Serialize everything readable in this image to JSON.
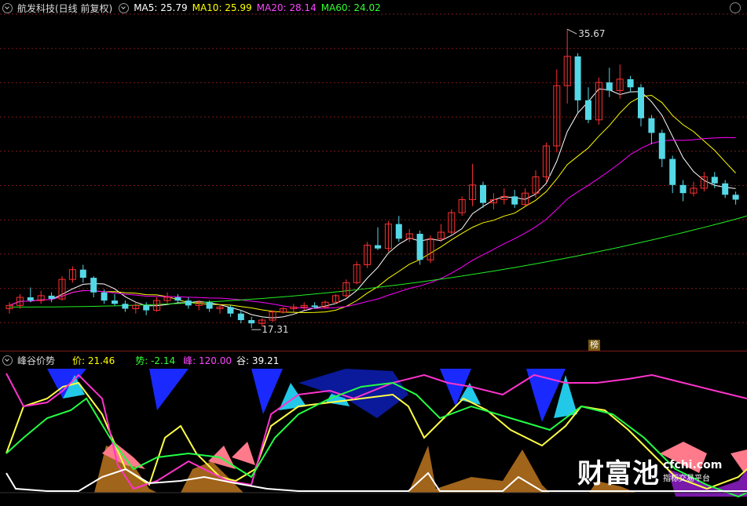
{
  "main_panel": {
    "title": "航发科技(日线 前复权)",
    "ma": [
      {
        "label": "MA5: 25.79",
        "color": "#ffffff"
      },
      {
        "label": "MA10: 25.99",
        "color": "#ffff00"
      },
      {
        "label": "MA20: 28.14",
        "color": "#ff00ff"
      },
      {
        "label": "MA60: 24.02",
        "color": "#00ff00"
      }
    ],
    "high_label": "35.67",
    "low_label": "17.31",
    "badge": "榜"
  },
  "indicator_panel": {
    "title": "峰谷价势",
    "values": [
      {
        "label": "价: 21.46",
        "color": "#ffff00"
      },
      {
        "label": "势: -2.14",
        "color": "#00ff00"
      },
      {
        "label": "峰: 120.00",
        "color": "#ff00ff"
      },
      {
        "label": "谷: 39.21",
        "color": "#ffffff"
      }
    ]
  },
  "watermark": {
    "big": "财富池",
    "site": "cfchi.com",
    "tagline": "指标交易平台"
  },
  "colors": {
    "up": "#ff3030",
    "down": "#55d8e6",
    "grid": "#7a1a1a"
  },
  "chart_data": {
    "type": "candlestick",
    "price_range": [
      16.5,
      36.5
    ],
    "candles": [
      [
        18.5,
        18.9,
        18.2,
        18.7
      ],
      [
        18.7,
        19.4,
        18.5,
        19.2
      ],
      [
        19.2,
        19.8,
        18.9,
        19.0
      ],
      [
        19.0,
        19.6,
        18.8,
        19.3
      ],
      [
        19.3,
        19.5,
        18.9,
        19.1
      ],
      [
        19.1,
        20.5,
        19.0,
        20.3
      ],
      [
        20.3,
        21.1,
        20.1,
        20.9
      ],
      [
        20.9,
        21.2,
        20.1,
        20.4
      ],
      [
        20.4,
        20.5,
        19.2,
        19.5
      ],
      [
        19.5,
        19.7,
        18.8,
        19.0
      ],
      [
        19.0,
        19.4,
        18.7,
        18.8
      ],
      [
        18.8,
        19.0,
        18.3,
        18.5
      ],
      [
        18.5,
        18.9,
        18.2,
        18.7
      ],
      [
        18.7,
        18.9,
        18.1,
        18.4
      ],
      [
        18.4,
        19.2,
        18.3,
        19.0
      ],
      [
        19.0,
        19.5,
        18.8,
        19.2
      ],
      [
        19.2,
        19.4,
        18.9,
        19.0
      ],
      [
        19.0,
        19.2,
        18.5,
        18.7
      ],
      [
        18.7,
        19.0,
        18.4,
        18.9
      ],
      [
        18.9,
        19.0,
        18.3,
        18.5
      ],
      [
        18.5,
        18.8,
        18.2,
        18.6
      ],
      [
        18.6,
        18.7,
        18.0,
        18.2
      ],
      [
        18.2,
        18.4,
        17.6,
        17.8
      ],
      [
        17.8,
        18.0,
        17.31,
        17.6
      ],
      [
        17.6,
        17.9,
        17.4,
        17.8
      ],
      [
        17.8,
        18.4,
        17.7,
        18.3
      ],
      [
        18.3,
        18.6,
        18.2,
        18.5
      ],
      [
        18.5,
        18.8,
        18.3,
        18.6
      ],
      [
        18.6,
        18.9,
        18.4,
        18.7
      ],
      [
        18.7,
        18.9,
        18.5,
        18.6
      ],
      [
        18.6,
        19.0,
        18.5,
        18.9
      ],
      [
        18.9,
        19.4,
        18.8,
        19.3
      ],
      [
        19.3,
        20.3,
        19.2,
        20.1
      ],
      [
        20.1,
        21.4,
        20.0,
        21.2
      ],
      [
        21.2,
        22.6,
        21.0,
        22.4
      ],
      [
        22.4,
        23.5,
        22.1,
        22.2
      ],
      [
        22.2,
        23.9,
        22.0,
        23.7
      ],
      [
        23.7,
        24.2,
        22.6,
        22.8
      ],
      [
        22.8,
        23.4,
        22.6,
        23.1
      ],
      [
        23.1,
        23.3,
        21.2,
        21.5
      ],
      [
        21.5,
        23.0,
        21.3,
        22.8
      ],
      [
        22.8,
        23.7,
        22.6,
        23.2
      ],
      [
        23.2,
        24.6,
        23.0,
        24.4
      ],
      [
        24.4,
        25.4,
        24.2,
        25.2
      ],
      [
        25.2,
        27.4,
        24.8,
        26.1
      ],
      [
        26.1,
        26.3,
        24.7,
        25.0
      ],
      [
        25.0,
        25.6,
        24.6,
        25.2
      ],
      [
        25.2,
        25.9,
        24.9,
        25.4
      ],
      [
        25.4,
        25.8,
        24.7,
        24.9
      ],
      [
        24.9,
        25.9,
        24.8,
        25.6
      ],
      [
        25.6,
        27.0,
        25.3,
        26.6
      ],
      [
        26.6,
        28.7,
        26.3,
        28.5
      ],
      [
        28.5,
        33.2,
        28.1,
        32.2
      ],
      [
        32.2,
        35.67,
        31.1,
        34.0
      ],
      [
        34.0,
        34.2,
        30.5,
        31.3
      ],
      [
        31.3,
        32.1,
        29.9,
        30.1
      ],
      [
        30.1,
        32.7,
        29.8,
        32.4
      ],
      [
        32.4,
        33.3,
        31.5,
        31.9
      ],
      [
        31.9,
        33.5,
        31.4,
        32.6
      ],
      [
        32.6,
        32.8,
        31.8,
        32.1
      ],
      [
        32.1,
        32.3,
        29.7,
        30.2
      ],
      [
        30.2,
        30.4,
        28.6,
        29.3
      ],
      [
        29.3,
        29.5,
        27.2,
        27.7
      ],
      [
        27.7,
        27.9,
        25.6,
        26.1
      ],
      [
        26.1,
        26.4,
        25.1,
        25.6
      ],
      [
        25.6,
        26.3,
        25.4,
        25.9
      ],
      [
        25.9,
        26.9,
        25.7,
        26.6
      ],
      [
        26.6,
        26.9,
        25.9,
        26.2
      ],
      [
        26.2,
        26.4,
        25.3,
        25.5
      ],
      [
        25.5,
        25.7,
        24.9,
        25.2
      ]
    ]
  }
}
